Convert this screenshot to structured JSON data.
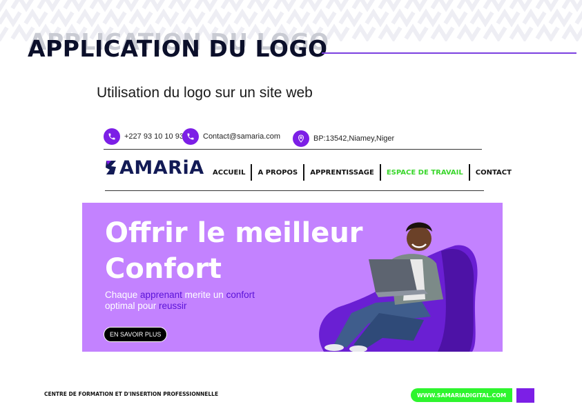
{
  "slide": {
    "title": "APPLICATION DU LOGO",
    "subtitle": "Utilisation du logo sur un site web",
    "accent_color": "#7b3fe0"
  },
  "website": {
    "topbar": {
      "phone": "+227 93 10 10 93",
      "email": "Contact@samaria.com",
      "address": "BP:13542,Niamey,Niger",
      "icons": [
        "phone-icon",
        "phone-icon",
        "location-icon"
      ]
    },
    "logo_text": "AMARiA",
    "nav": {
      "items": [
        "ACCUEIL",
        "A PROPOS",
        "APPRENTISSAGE",
        "ESPACE DE TRAVAIL",
        "CONTACT"
      ],
      "active_color": "#39d62b"
    },
    "hero": {
      "line1": "Offrir le meilleur",
      "line2": "Confort",
      "text_a": "Chaque ",
      "text_b": "apprenant",
      "text_c": " merite un ",
      "text_d": "confort",
      "text_e": "optimal pour ",
      "text_f": "reussir",
      "button": "EN SAVOIR PLUS",
      "bg_color": "#c382ff"
    }
  },
  "footer": {
    "left": "CENTRE DE FORMATION ET D'INSERTION PROFESSIONNELLE",
    "url": "WWW.SAMARIADIGITAL.COM",
    "url_color": "#2ef52e",
    "square_color": "#7c1fe6"
  }
}
